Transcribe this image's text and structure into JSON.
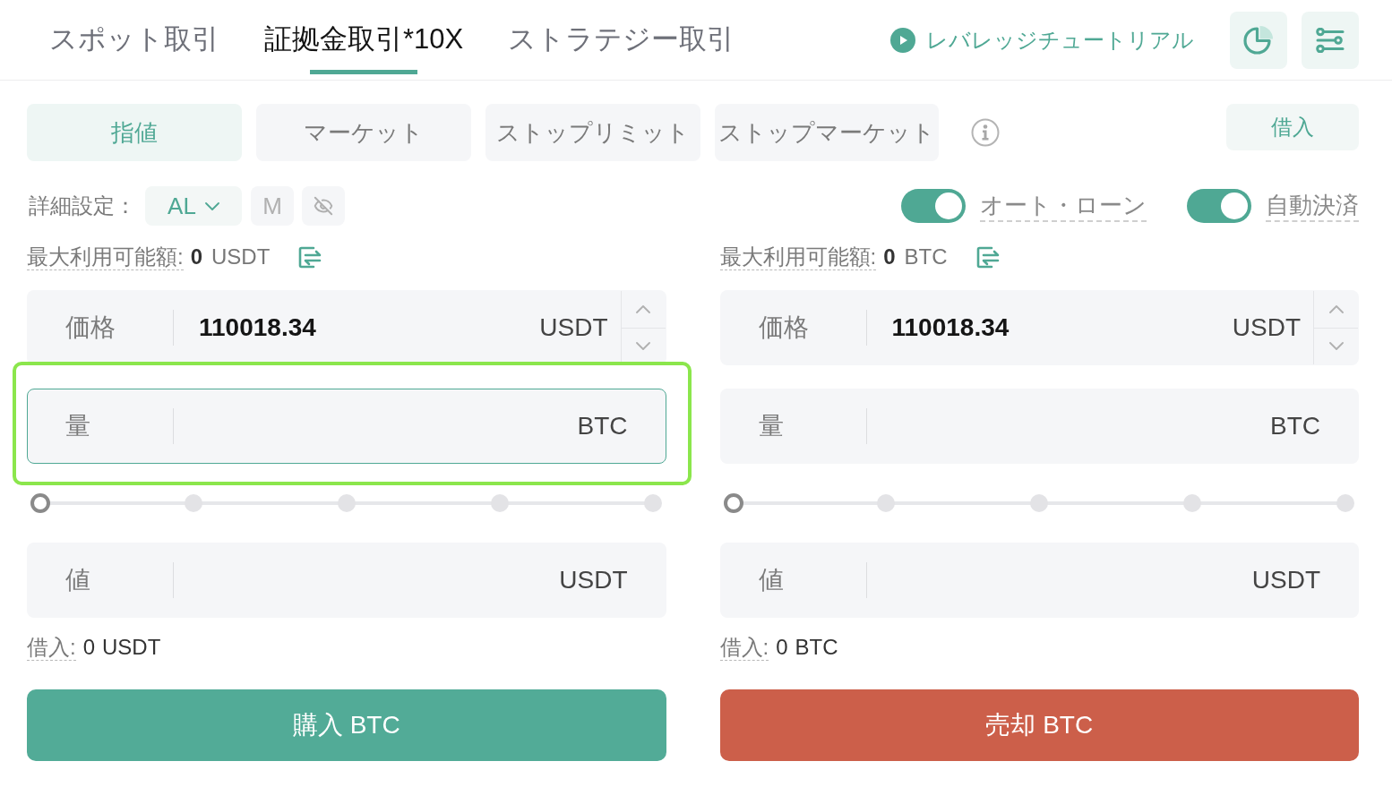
{
  "top_tabs": [
    {
      "label": "スポット取引",
      "selected": false
    },
    {
      "label": "証拠金取引*10X",
      "selected": true
    },
    {
      "label": "ストラテジー取引",
      "selected": false
    }
  ],
  "tutorial_link": {
    "label": "レバレッジチュートリアル"
  },
  "order_types": [
    {
      "label": "指値",
      "selected": true
    },
    {
      "label": "マーケット",
      "selected": false
    },
    {
      "label": "ストップリミット",
      "selected": false
    },
    {
      "label": "ストップマーケット",
      "selected": false
    }
  ],
  "borrow_button": {
    "label": "借入"
  },
  "advanced": {
    "label": "詳細設定：",
    "mode_selector": {
      "label": "AL"
    },
    "m_button": {
      "label": "M"
    }
  },
  "toggles": [
    {
      "label": "オート・ローン",
      "on": true
    },
    {
      "label": "自動決済",
      "on": true
    }
  ],
  "panels": [
    {
      "available": {
        "label": "最大利用可能額:",
        "amount": "0",
        "unit": "USDT"
      },
      "price_field": {
        "label": "価格",
        "value": "110018.34",
        "unit": "USDT",
        "focused": false
      },
      "amount_field": {
        "label": "量",
        "unit": "BTC",
        "focused": true,
        "highlighted": true
      },
      "slider": {
        "level": 0
      },
      "total_field": {
        "label": "値",
        "unit": "USDT",
        "focused": false
      },
      "borrowed": {
        "label": "借入:",
        "amount": "0",
        "unit": "USDT"
      },
      "submit": {
        "label": "購入 BTC",
        "kind": "buy"
      }
    },
    {
      "available": {
        "label": "最大利用可能額:",
        "amount": "0",
        "unit": "BTC"
      },
      "price_field": {
        "label": "価格",
        "value": "110018.34",
        "unit": "USDT",
        "focused": false
      },
      "amount_field": {
        "label": "量",
        "unit": "BTC",
        "focused": false
      },
      "slider": {
        "level": 0
      },
      "total_field": {
        "label": "値",
        "unit": "USDT",
        "focused": false
      },
      "borrowed": {
        "label": "借入:",
        "amount": "0",
        "unit": "BTC"
      },
      "submit": {
        "label": "売却 BTC",
        "kind": "sell"
      }
    }
  ]
}
